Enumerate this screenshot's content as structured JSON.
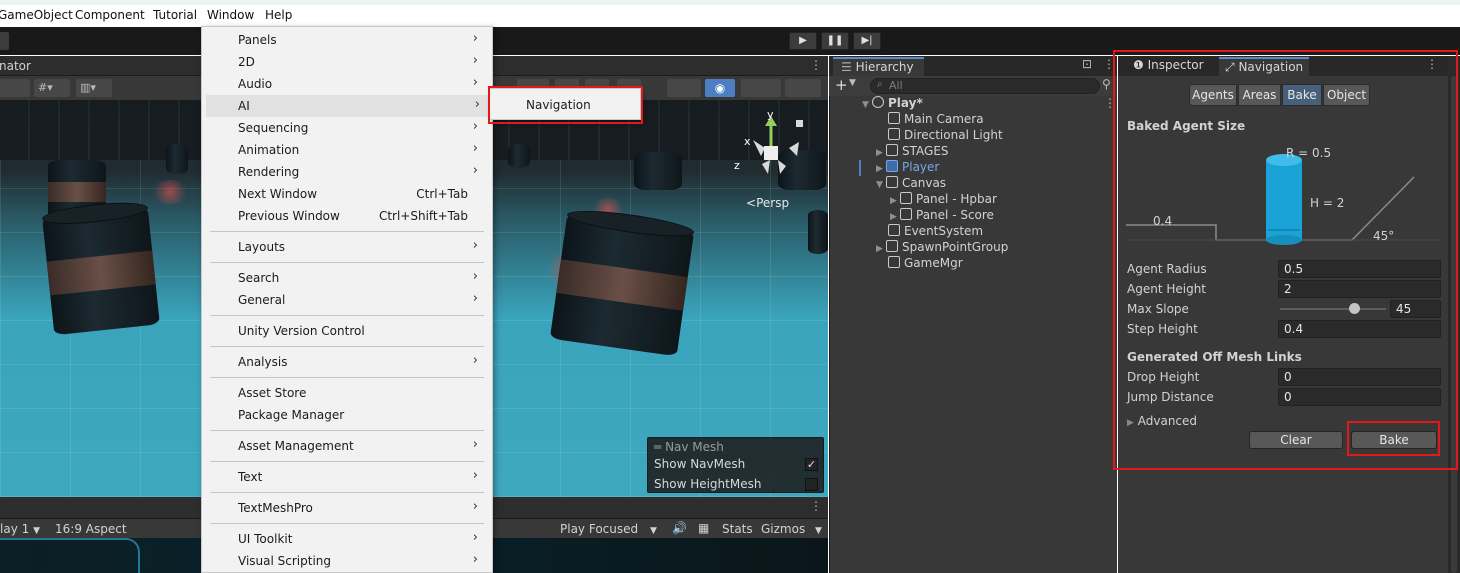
{
  "menubar": {
    "items": [
      "GameObject",
      "Component",
      "Tutorial",
      "Window",
      "Help"
    ]
  },
  "playbar": {
    "play": "▶",
    "pause": "❚❚",
    "step": "▶|"
  },
  "scene": {
    "tab_label": "nator",
    "persp_label": "Persp",
    "gizmo_axes": {
      "x": "x",
      "y": "y",
      "z": "z"
    },
    "status": {
      "display": "lay 1",
      "aspect": "16:9 Aspect",
      "play_focused": "Play Focused",
      "stats": "Stats",
      "gizmos": "Gizmos"
    }
  },
  "navmesh_overlay": {
    "title": "Nav Mesh",
    "show_navmesh": "Show NavMesh",
    "show_heightmesh": "Show HeightMesh",
    "show_navmesh_checked": true,
    "show_heightmesh_checked": false
  },
  "window_menu": {
    "items": [
      {
        "label": "Panels",
        "submenu": true
      },
      {
        "label": "2D",
        "submenu": true
      },
      {
        "label": "Audio",
        "submenu": true
      },
      {
        "label": "AI",
        "submenu": true
      },
      {
        "label": "Sequencing",
        "submenu": true
      },
      {
        "label": "Animation",
        "submenu": true
      },
      {
        "label": "Rendering",
        "submenu": true
      },
      {
        "label": "Next Window",
        "shortcut": "Ctrl+Tab"
      },
      {
        "label": "Previous Window",
        "shortcut": "Ctrl+Shift+Tab"
      },
      {
        "label": "Layouts",
        "submenu": true
      },
      {
        "label": "Search",
        "submenu": true
      },
      {
        "label": "General",
        "submenu": true
      },
      {
        "label": "Unity Version Control"
      },
      {
        "label": "Analysis",
        "submenu": true
      },
      {
        "label": "Asset Store"
      },
      {
        "label": "Package Manager"
      },
      {
        "label": "Asset Management",
        "submenu": true
      },
      {
        "label": "Text",
        "submenu": true
      },
      {
        "label": "TextMeshPro",
        "submenu": true
      },
      {
        "label": "UI Toolkit",
        "submenu": true
      },
      {
        "label": "Visual Scripting",
        "submenu": true
      }
    ],
    "highlighted": "AI",
    "submenu": {
      "label": "Navigation"
    }
  },
  "hierarchy": {
    "tab_label": "Hierarchy",
    "search_placeholder": "All",
    "scene": "Play*",
    "items": [
      {
        "name": "Main Camera"
      },
      {
        "name": "Directional Light"
      },
      {
        "name": "STAGES"
      },
      {
        "name": "Player",
        "color": "#7aa6e6"
      },
      {
        "name": "Canvas"
      },
      {
        "name": "Panel - Hpbar"
      },
      {
        "name": "Panel - Score"
      },
      {
        "name": "EventSystem"
      },
      {
        "name": "SpawnPointGroup"
      },
      {
        "name": "GameMgr"
      }
    ]
  },
  "inspector": {
    "tabs": [
      "Inspector",
      "Navigation"
    ],
    "segments": [
      "Agents",
      "Areas",
      "Bake",
      "Object"
    ],
    "active_segment": "Bake",
    "baked_agent_size": {
      "title": "Baked Agent Size",
      "radius_label": "R = 0.5",
      "height_label": "H = 2",
      "step_label": "0.4",
      "slope_label": "45°"
    },
    "fields": {
      "agent_radius": {
        "label": "Agent Radius",
        "value": "0.5"
      },
      "agent_height": {
        "label": "Agent Height",
        "value": "2"
      },
      "max_slope": {
        "label": "Max Slope",
        "value": "45",
        "slider_fraction": 0.7
      },
      "step_height": {
        "label": "Step Height",
        "value": "0.4"
      }
    },
    "off_mesh": {
      "title": "Generated Off Mesh Links",
      "drop_height": {
        "label": "Drop Height",
        "value": "0"
      },
      "jump_distance": {
        "label": "Jump Distance",
        "value": "0"
      }
    },
    "advanced": "Advanced",
    "clear_button": "Clear",
    "bake_button": "Bake"
  },
  "colors": {
    "highlight_red": "#e0191b",
    "cylinder": "#1aa3d6",
    "accent_blue": "#4b7fc1"
  }
}
